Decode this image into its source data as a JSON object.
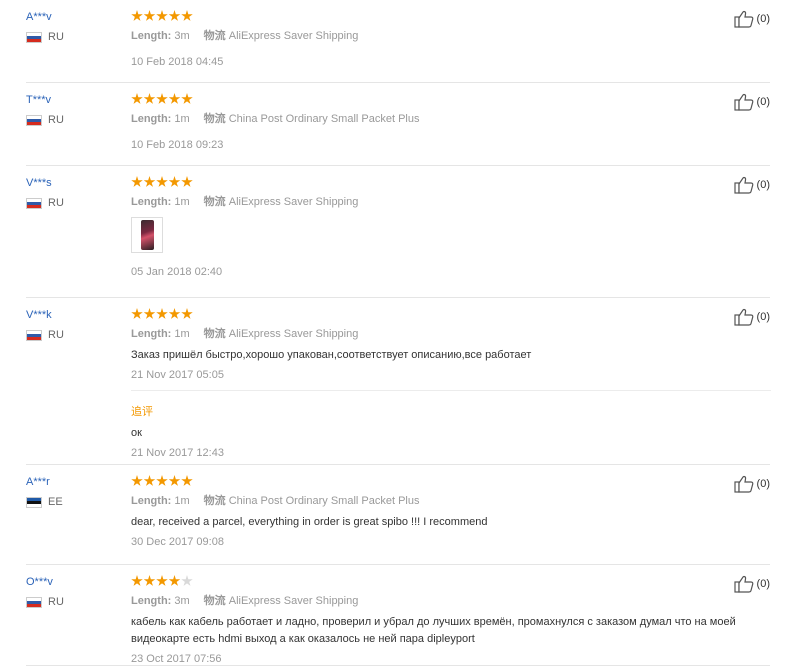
{
  "reviews": [
    {
      "user": "A***v",
      "country": "RU",
      "flag": "ru",
      "stars": 5,
      "length_label": "Length:",
      "length": "3m",
      "ship_label": "物流",
      "shipping": "AliExpress Saver Shipping",
      "text": "",
      "date": "10 Feb 2018 04:45",
      "likes": "(0)"
    },
    {
      "user": "T***v",
      "country": "RU",
      "flag": "ru",
      "stars": 5,
      "length_label": "Length:",
      "length": "1m",
      "ship_label": "物流",
      "shipping": "China Post Ordinary Small Packet Plus",
      "text": "",
      "date": "10 Feb 2018 09:23",
      "likes": "(0)"
    },
    {
      "user": "V***s",
      "country": "RU",
      "flag": "ru",
      "stars": 5,
      "length_label": "Length:",
      "length": "1m",
      "ship_label": "物流",
      "shipping": "AliExpress Saver Shipping",
      "text": "",
      "date": "05 Jan 2018 02:40",
      "likes": "(0)",
      "has_image": true
    },
    {
      "user": "V***k",
      "country": "RU",
      "flag": "ru",
      "stars": 5,
      "length_label": "Length:",
      "length": "1m",
      "ship_label": "物流",
      "shipping": "AliExpress Saver Shipping",
      "text": "Заказ пришёл быстро,хорошо упакован,соответствует описанию,все работает",
      "date": "21 Nov 2017 05:05",
      "likes": "(0)",
      "followup": {
        "label": "追评",
        "text": "ок",
        "date": "21 Nov 2017 12:43"
      }
    },
    {
      "user": "A***r",
      "country": "EE",
      "flag": "ee",
      "stars": 5,
      "length_label": "Length:",
      "length": "1m",
      "ship_label": "物流",
      "shipping": "China Post Ordinary Small Packet Plus",
      "text": "dear, received a parcel, everything in order is great spibo !!! I recommend",
      "date": "30 Dec 2017 09:08",
      "likes": "(0)"
    },
    {
      "user": "O***v",
      "country": "RU",
      "flag": "ru",
      "stars": 4,
      "length_label": "Length:",
      "length": "3m",
      "ship_label": "物流",
      "shipping": "AliExpress Saver Shipping",
      "text": "кабель как кабель работает и ладно, проверил и убрал до лучших времён, промахнулся с заказом думал что на моей видеокарте есть hdmi выход а как оказалось не ней пара dipleyport",
      "date": "23 Oct 2017 07:56",
      "likes": "(0)"
    }
  ],
  "colors": {
    "star": "#f39800",
    "star_empty": "#d9d9d9",
    "username": "#2b63b8",
    "followup": "#f39800"
  },
  "icons": {
    "like": "thumbs-up-icon"
  }
}
